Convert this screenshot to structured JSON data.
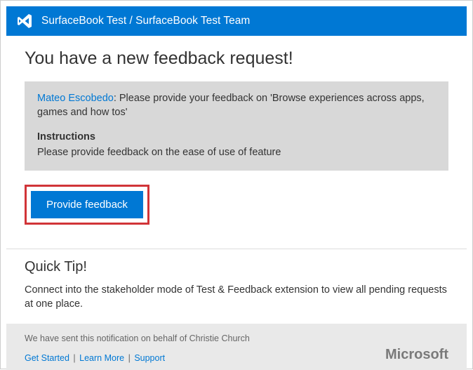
{
  "header": {
    "title": "SurfaceBook Test / SurfaceBook Test Team"
  },
  "main": {
    "heading": "You have a new feedback request!",
    "request": {
      "requester_name": "Mateo Escobedo",
      "message": ": Please provide your feedback on 'Browse experiences across  apps, games and how tos'"
    },
    "instructions_label": "Instructions",
    "instructions_body": "Please provide feedback on the ease of use of feature",
    "cta_label": "Provide feedback"
  },
  "tip": {
    "title": "Quick Tip!",
    "body": "Connect into the stakeholder mode of Test & Feedback extension to view all pending requests at one place."
  },
  "footer": {
    "behalf": "We have sent this notification on behalf of  Christie Church",
    "links": {
      "get_started": "Get Started",
      "learn_more": "Learn More",
      "support": "Support"
    },
    "brand": "Microsoft"
  }
}
